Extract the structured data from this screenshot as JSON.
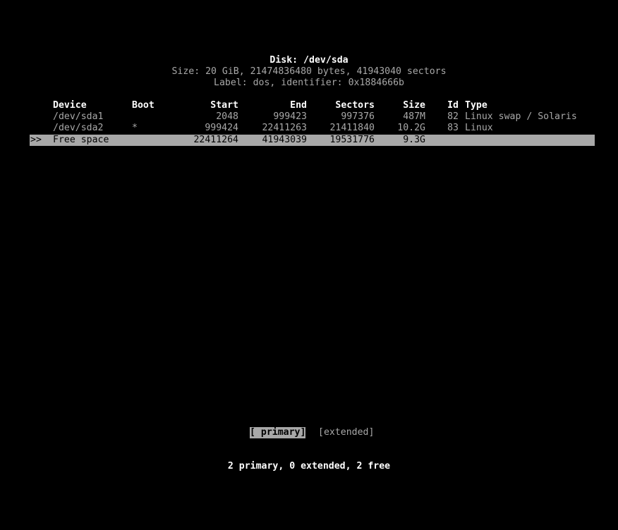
{
  "disk": {
    "title": "Disk: /dev/sda",
    "size_line": "Size: 20 GiB, 21474836480 bytes, 41943040 sectors",
    "label_line": "Label: dos, identifier: 0x1884666b"
  },
  "table": {
    "headers": {
      "device": "Device",
      "boot": "Boot",
      "start": "Start",
      "end": "End",
      "sectors": "Sectors",
      "size": "Size",
      "id": "Id",
      "type": "Type"
    },
    "rows": [
      {
        "cursor": "",
        "device": "/dev/sda1",
        "boot": "",
        "start": "2048",
        "end": "999423",
        "sectors": "997376",
        "size": "487M",
        "id": "82",
        "type": "Linux swap / Solaris"
      },
      {
        "cursor": "",
        "device": "/dev/sda2",
        "boot": "*",
        "start": "999424",
        "end": "22411263",
        "sectors": "21411840",
        "size": "10.2G",
        "id": "83",
        "type": "Linux"
      },
      {
        "cursor": ">>",
        "device": "Free space",
        "boot": "",
        "start": "22411264",
        "end": "41943039",
        "sectors": "19531776",
        "size": "9.3G",
        "id": "",
        "type": ""
      }
    ]
  },
  "menu": {
    "primary": "[ primary]",
    "extended": "[extended]"
  },
  "status": "2 primary, 0 extended, 2 free",
  "colors": {
    "background": "#000000",
    "foreground": "#a8a8a8",
    "highlight": "#ffffff",
    "selection_bg": "#a8a8a8",
    "selection_fg": "#000000"
  }
}
